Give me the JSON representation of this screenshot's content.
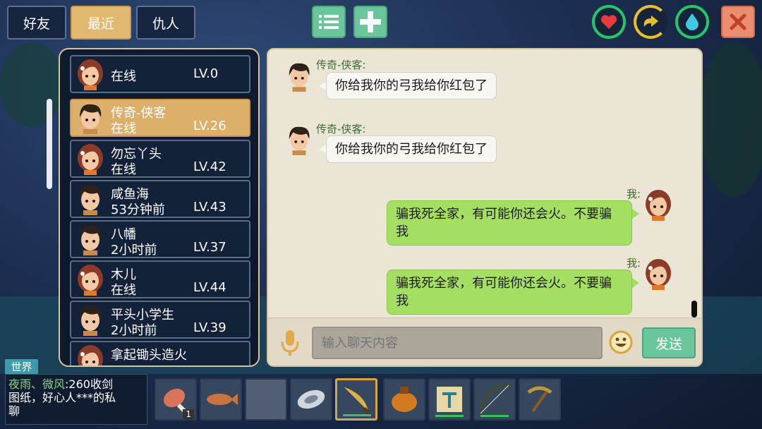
{
  "tabs": [
    {
      "label": "好友",
      "active": false
    },
    {
      "label": "最近",
      "active": true
    },
    {
      "label": "仇人",
      "active": false
    }
  ],
  "toolbar": {
    "list_icon": "list-icon",
    "add_icon": "plus-icon"
  },
  "status_icons": [
    {
      "icon": "heart-icon",
      "color": "#e73b3b",
      "ring": "#27c46a"
    },
    {
      "icon": "hunger-icon",
      "color": "#e8c02b",
      "ring": "#e8c02b"
    },
    {
      "icon": "water-drop-icon",
      "color": "#3ecbe0",
      "ring": "#27c46a"
    }
  ],
  "close_icon": "close-icon",
  "friends": [
    {
      "name": "",
      "status": "在线",
      "level": "LV.0",
      "avatar": "girl"
    },
    {
      "name": "传奇-侠客",
      "status": "在线",
      "level": "LV.26",
      "avatar": "boy",
      "selected": true
    },
    {
      "name": "勿忘丫头",
      "status": "在线",
      "level": "LV.42",
      "avatar": "girl"
    },
    {
      "name": "咸鱼海",
      "status": "53分钟前",
      "level": "LV.43",
      "avatar": "boy"
    },
    {
      "name": "八幡",
      "status": "2小时前",
      "level": "LV.37",
      "avatar": "boy"
    },
    {
      "name": "木儿",
      "status": "在线",
      "level": "LV.44",
      "avatar": "girl"
    },
    {
      "name": "平头小学生",
      "status": "2小时前",
      "level": "LV.39",
      "avatar": "boy"
    },
    {
      "name": "拿起锄头造火",
      "status": "",
      "level": "",
      "avatar": "girl"
    }
  ],
  "messages": [
    {
      "sender": "传奇-侠客:",
      "text": "你给我你的弓我给你红包了",
      "mine": false
    },
    {
      "sender": "传奇-侠客:",
      "text": "你给我你的弓我给你红包了",
      "mine": false
    },
    {
      "sender": "我:",
      "text_line1": "骗我死全家，有可能你还会火。不要骗",
      "text_line2": "我",
      "mine": true
    },
    {
      "sender": "我:",
      "text_line1": "骗我死全家，有可能你还会火。不要骗",
      "text_line2": "我",
      "mine": true
    }
  ],
  "input": {
    "placeholder": "输入聊天内容"
  },
  "send_label": "发送",
  "world": {
    "badge": "世界",
    "sender": "夜雨、微风",
    "text_line1": ":260收剑",
    "text_line2": "图纸，好心人***的私",
    "text_line3": "聊"
  },
  "hotbar": [
    {
      "icon": "meat-leg-icon",
      "count": "1"
    },
    {
      "icon": "fish-icon"
    },
    {
      "icon": "empty-slot-icon"
    },
    {
      "icon": "shell-icon"
    },
    {
      "icon": "curved-sword-icon",
      "selected": true
    },
    {
      "icon": "bag-icon"
    },
    {
      "icon": "blueprint-icon"
    },
    {
      "icon": "bow-icon"
    },
    {
      "icon": "pickaxe-icon"
    }
  ]
}
